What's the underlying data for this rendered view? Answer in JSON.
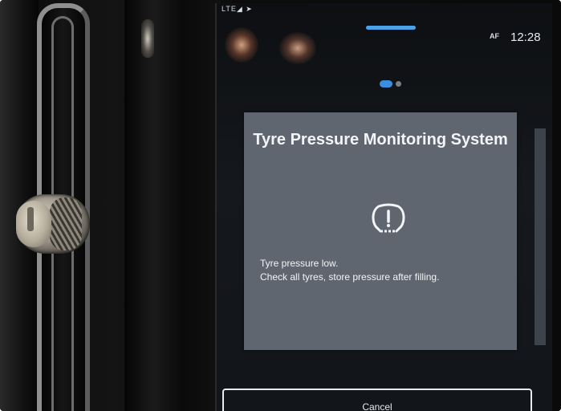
{
  "status_bar": {
    "signal_text": "LTE◢ ➤",
    "af_label": "AF",
    "time": "12:28"
  },
  "dialog": {
    "title": "Tyre Pressure Monitoring System",
    "icon": "tpms-warning-icon",
    "message_line1": "Tyre pressure low.",
    "message_line2": "Check all tyres, store pressure after filling."
  },
  "buttons": {
    "cancel_label": "Cancel"
  },
  "colors": {
    "dialog_background": "#5f6670",
    "accent_blue": "#3a8de0",
    "text": "#f2f4f7"
  }
}
